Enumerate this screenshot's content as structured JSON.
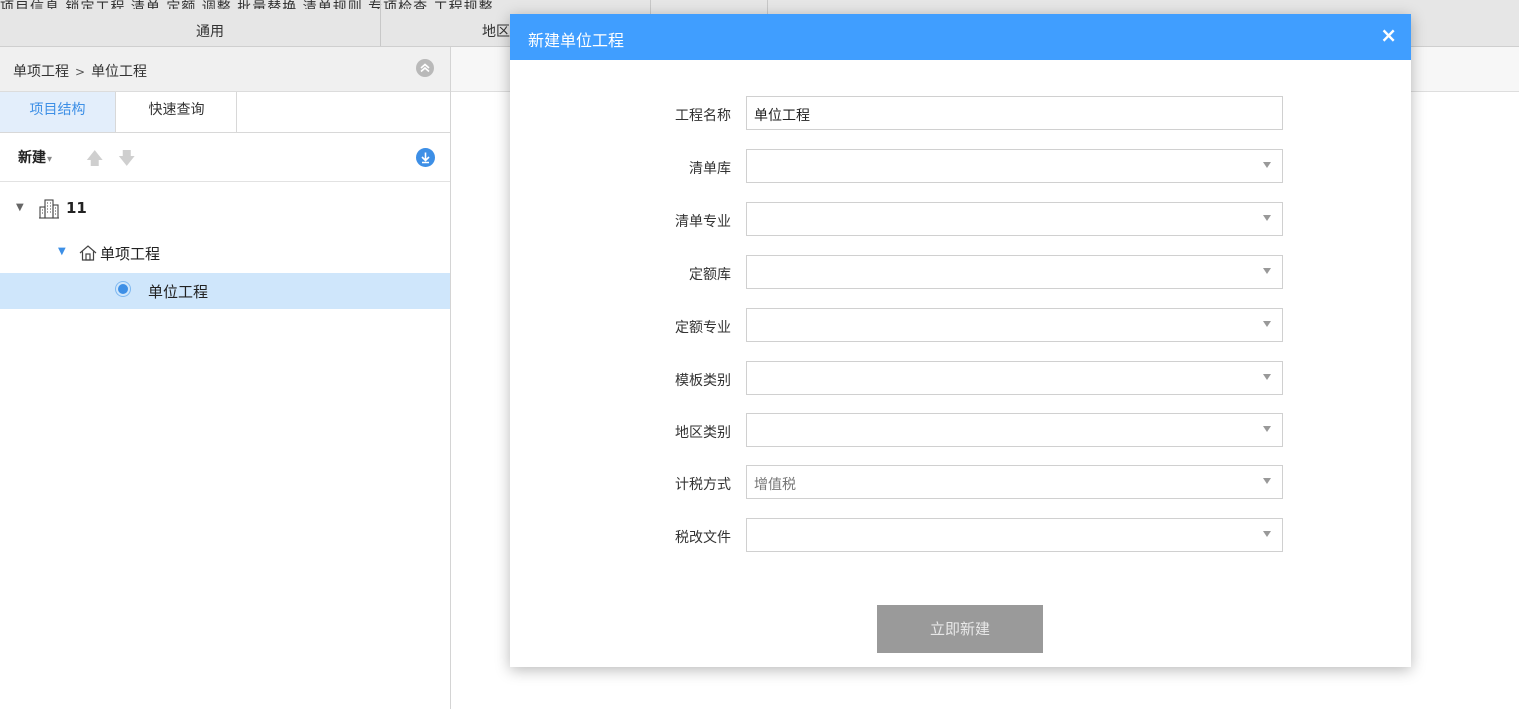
{
  "ribbon": {
    "cut_text": "项目信息  锁定工程  清单  定额  调整  批量替换  清单规则  专项检查  工程规整",
    "group_general": "通用",
    "group_region": "地区"
  },
  "left": {
    "breadcrumb_parent": "单项工程",
    "breadcrumb_sep": ">",
    "breadcrumb_current": "单位工程",
    "tabs": [
      {
        "label": "项目结构",
        "active": true
      },
      {
        "label": "快速查询",
        "active": false
      }
    ],
    "toolbar": {
      "new_label": "新建"
    },
    "tree": {
      "root": {
        "label": "11",
        "icon": "building-icon"
      },
      "single": {
        "label": "单项工程",
        "icon": "house-icon"
      },
      "unit": {
        "label": "单位工程",
        "icon": "radio-dot-icon",
        "selected": true
      }
    }
  },
  "modal": {
    "title": "新建单位工程",
    "close_glyph": "×",
    "fields": [
      {
        "label": "工程名称",
        "value": "单位工程",
        "type": "text"
      },
      {
        "label": "清单库",
        "value": "",
        "type": "select"
      },
      {
        "label": "清单专业",
        "value": "",
        "type": "select"
      },
      {
        "label": "定额库",
        "value": "",
        "type": "select"
      },
      {
        "label": "定额专业",
        "value": "",
        "type": "select"
      },
      {
        "label": "模板类别",
        "value": "",
        "type": "select"
      },
      {
        "label": "地区类别",
        "value": "",
        "type": "select"
      },
      {
        "label": "计税方式",
        "value": "增值税",
        "type": "select"
      },
      {
        "label": "税改文件",
        "value": "",
        "type": "select"
      }
    ],
    "submit_label": "立即新建"
  },
  "colors": {
    "accent": "#409eff",
    "tab_active_bg": "#e3eefb",
    "selected_row_bg": "#cfe6fb",
    "submit_disabled": "#9a9a9a"
  }
}
